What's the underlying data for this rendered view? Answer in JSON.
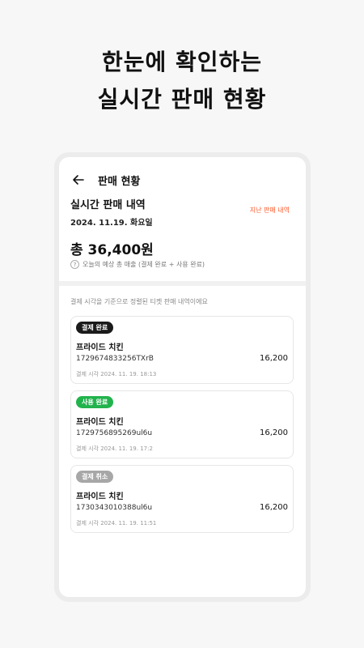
{
  "promo": {
    "line1": "한눈에 확인하는",
    "line2": "실시간 판매 현황"
  },
  "header": {
    "title": "판매 현황",
    "back_icon": "arrow-left-icon"
  },
  "summary": {
    "section_title": "실시간 판매 내역",
    "past_link": "지난 판매 내역",
    "date": "2024. 11.19. 화요일",
    "total": "총 36,400원",
    "help_icon_glyph": "?",
    "help_text": "오늘의 예상 총 매출 (결제 완료 + 사용 완료)"
  },
  "list": {
    "caption": "결제 시각을 기준으로 정렬된 티켓 판매 내역이에요",
    "items": [
      {
        "status": "결제 완료",
        "status_color": "#1a1a1a",
        "name": "프라이드 치킨",
        "order_no": "1729674833256TXrB",
        "amount": "16,200",
        "time": "결제 시각 2024. 11. 19. 18:13"
      },
      {
        "status": "사용 완료",
        "status_color": "#22b34d",
        "name": "프라이드 치킨",
        "order_no": "1729756895269ul6u",
        "amount": "16,200",
        "time": "결제 시각 2024. 11. 19. 17:2"
      },
      {
        "status": "결제 취소",
        "status_color": "#a7a7a7",
        "name": "프라이드 치킨",
        "order_no": "1730343010388ul6u",
        "amount": "16,200",
        "time": "결제 시각 2024. 11. 19. 11:51"
      }
    ]
  },
  "colors": {
    "accent": "#ff5a2c",
    "background": "#f7f7f7"
  }
}
